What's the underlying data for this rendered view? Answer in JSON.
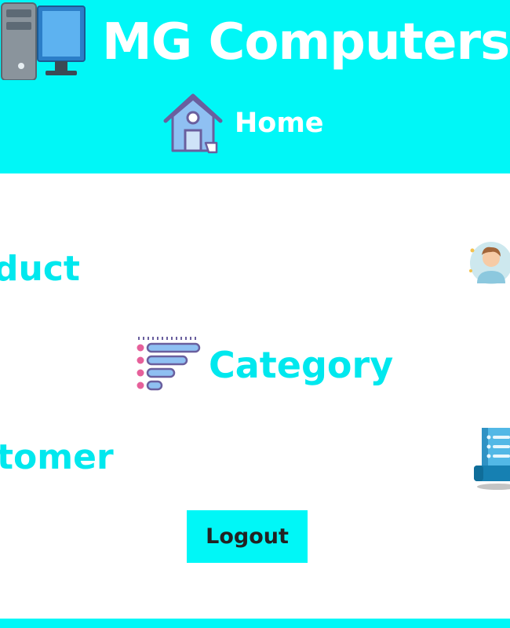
{
  "header": {
    "brand_title": "MG Computers",
    "brand_icon": "desktop-computer-icon",
    "nav": {
      "home_label": "Home",
      "home_icon": "house-icon"
    }
  },
  "menu": {
    "product_label": "duct",
    "category_label": "Category",
    "category_icon": "list-icon",
    "customer_label": "tomer",
    "user_icon": "user-avatar-icon",
    "document_icon": "document-icon"
  },
  "actions": {
    "logout_label": "Logout"
  },
  "colors": {
    "accent": "#00f7f7",
    "menu_text": "#00e8ee",
    "background": "#ffffff",
    "button_text": "#222222"
  }
}
